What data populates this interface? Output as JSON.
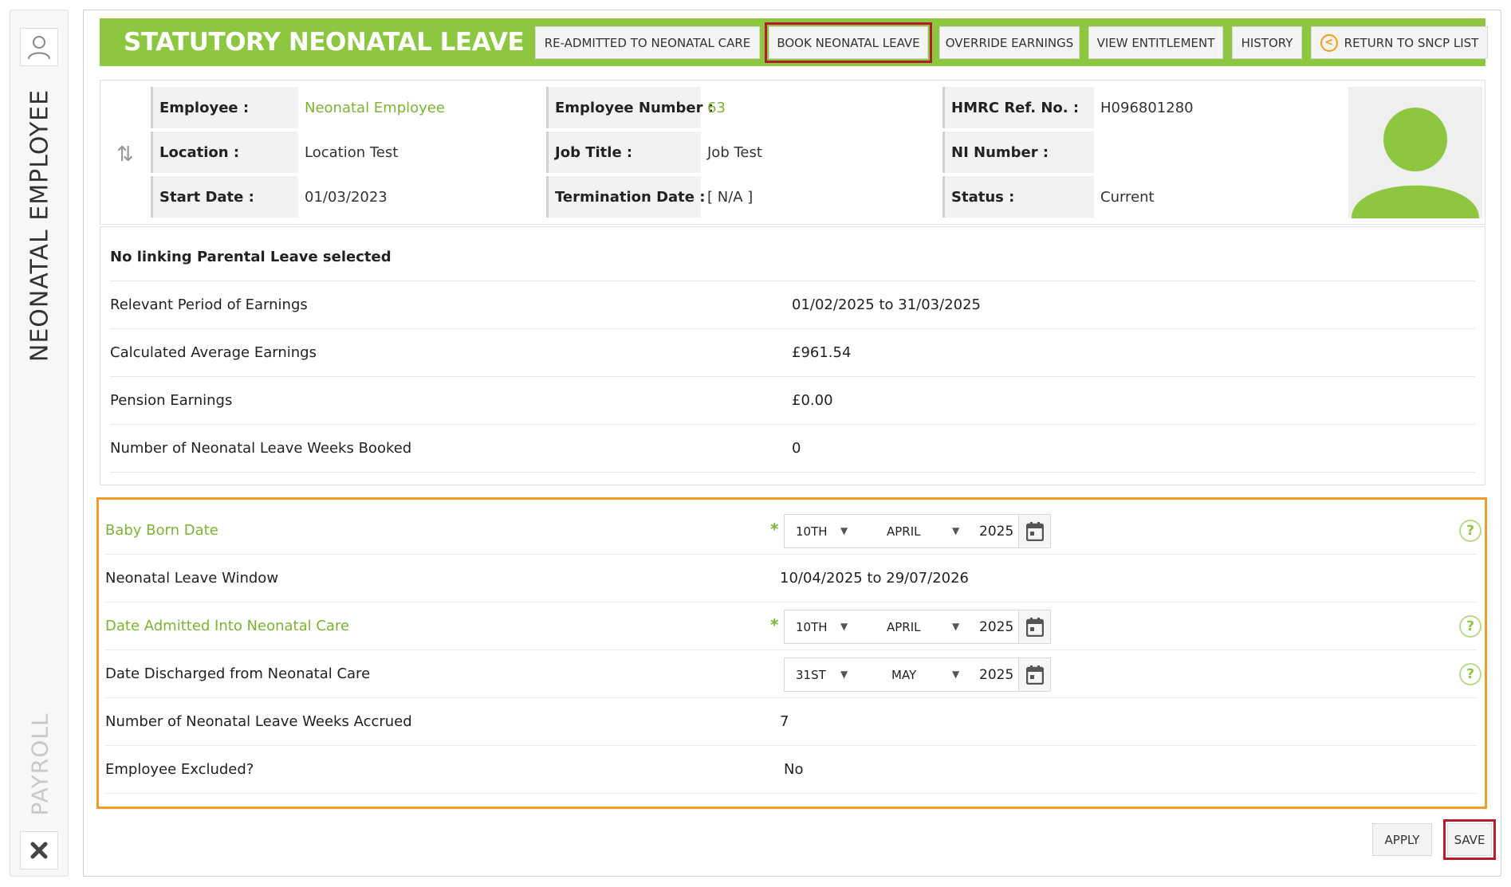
{
  "sidebar": {
    "employee_label": "NEONATAL EMPLOYEE",
    "payroll_label": "PAYROLL",
    "user_icon": "user-icon",
    "close_icon": "close-icon"
  },
  "header": {
    "title": "STATUTORY NEONATAL LEAVE",
    "buttons": {
      "readmitted": "RE-ADMITTED TO NEONATAL CARE",
      "book": "BOOK NEONATAL LEAVE",
      "override": "OVERRIDE EARNINGS",
      "entitlement": "VIEW ENTITLEMENT",
      "history": "HISTORY",
      "return": "RETURN TO SNCP LIST"
    },
    "active_button": "book",
    "accent_color": "#8dc63f"
  },
  "employee": {
    "labels": {
      "employee": "Employee :",
      "employee_number": "Employee Number :",
      "hmrc": "HMRC Ref. No. :",
      "location": "Location :",
      "job_title": "Job Title :",
      "ni_number": "NI Number :",
      "start_date": "Start Date :",
      "termination_date": "Termination Date :",
      "status": "Status :"
    },
    "values": {
      "employee": "Neonatal Employee",
      "employee_number": "63",
      "hmrc": "H096801280",
      "location": "Location Test",
      "job_title": "Job Test",
      "ni_number": "",
      "start_date": "01/03/2023",
      "termination_date": "[ N/A ]",
      "status": "Current"
    }
  },
  "summary": {
    "title": "No linking Parental Leave selected",
    "rows": [
      {
        "label": "Relevant Period of Earnings",
        "value": "01/02/2025 to 31/03/2025"
      },
      {
        "label": "Calculated Average Earnings",
        "value": "£961.54"
      },
      {
        "label": "Pension Earnings",
        "value": "£0.00"
      },
      {
        "label": "Number of Neonatal Leave Weeks Booked",
        "value": "0"
      }
    ]
  },
  "form": {
    "baby_born": {
      "label": "Baby Born Date",
      "day": "10TH",
      "month": "APRIL",
      "year": "2025"
    },
    "window": {
      "label": "Neonatal Leave Window",
      "value": "10/04/2025 to 29/07/2026"
    },
    "admitted": {
      "label": "Date Admitted Into Neonatal Care",
      "day": "10TH",
      "month": "APRIL",
      "year": "2025"
    },
    "discharged": {
      "label": "Date Discharged from Neonatal Care",
      "day": "31ST",
      "month": "MAY",
      "year": "2025"
    },
    "weeks_accrued": {
      "label": "Number of Neonatal Leave Weeks Accrued",
      "value": "7"
    },
    "excluded": {
      "label": "Employee Excluded?",
      "value": "No"
    },
    "required_mark": "*",
    "help_mark": "?",
    "highlight_color": "#f39c2b"
  },
  "footer": {
    "apply": "APPLY",
    "save": "SAVE"
  }
}
